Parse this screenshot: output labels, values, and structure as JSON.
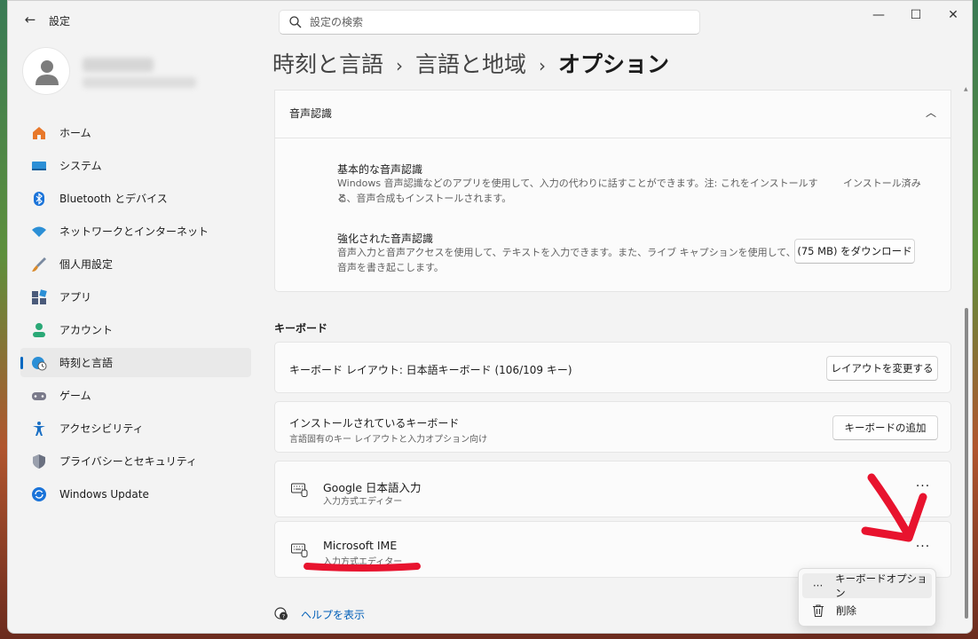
{
  "window": {
    "app_title": "設定",
    "back_icon": "back-arrow-icon",
    "controls": {
      "minimize": "—",
      "maximize": "☐",
      "close": "✕"
    }
  },
  "search": {
    "placeholder": "設定の検索"
  },
  "sidebar": {
    "items": [
      {
        "label": "ホーム",
        "icon": "home-icon",
        "color": "#e8782a"
      },
      {
        "label": "システム",
        "icon": "system-icon",
        "color": "#2b8fd6"
      },
      {
        "label": "Bluetooth とデバイス",
        "icon": "bluetooth-icon",
        "color": "#1a73d9"
      },
      {
        "label": "ネットワークとインターネット",
        "icon": "wifi-icon",
        "color": "#2b8fd6"
      },
      {
        "label": "個人用設定",
        "icon": "brush-icon",
        "color": "#d98a2b"
      },
      {
        "label": "アプリ",
        "icon": "apps-icon",
        "color": "#4a5a7a"
      },
      {
        "label": "アカウント",
        "icon": "account-icon",
        "color": "#2aa876"
      },
      {
        "label": "時刻と言語",
        "icon": "globe-clock-icon",
        "color": "#2b8fd6",
        "active": true
      },
      {
        "label": "ゲーム",
        "icon": "gamepad-icon",
        "color": "#7a7a8a"
      },
      {
        "label": "アクセシビリティ",
        "icon": "accessibility-icon",
        "color": "#1a6fc4"
      },
      {
        "label": "プライバシーとセキュリティ",
        "icon": "shield-icon",
        "color": "#6a7080"
      },
      {
        "label": "Windows Update",
        "icon": "update-icon",
        "color": "#1a73d9"
      }
    ]
  },
  "breadcrumb": {
    "level1": "時刻と言語",
    "level2": "言語と地域",
    "current": "オプション",
    "separator": "›"
  },
  "speech": {
    "title": "音声認識",
    "basic": {
      "title": "基本的な音声認識",
      "desc_line1": "Windows 音声認識などのアプリを使用して、入力の代わりに話すことができます。注: これをインストールする",
      "desc_line2": "と、音声合成もインストールされます。",
      "status": "インストール済み"
    },
    "enhanced": {
      "title": "強化された音声認識",
      "desc_line1": "音声入力と音声アクセスを使用して、テキストを入力できます。また、ライブ キャプションを使用して、",
      "desc_line2": "音声を書き起こします。",
      "button": "(75 MB) をダウンロード"
    }
  },
  "keyboard": {
    "section": "キーボード",
    "layout": {
      "label": "キーボード レイアウト: 日本語キーボード (106/109 キー)",
      "button": "レイアウトを変更する"
    },
    "installed": {
      "title": "インストールされているキーボード",
      "subtitle": "言語固有のキー レイアウトと入力オプション向け",
      "button": "キーボードの追加"
    },
    "imes": [
      {
        "name": "Google 日本語入力",
        "type": "入力方式エディター"
      },
      {
        "name": "Microsoft IME",
        "type": "入力方式エディター"
      }
    ],
    "more_label": "···"
  },
  "help": {
    "label": "ヘルプを表示"
  },
  "context_menu": {
    "items": [
      {
        "label": "キーボードオプション",
        "icon": "more-dots-icon"
      },
      {
        "label": "削除",
        "icon": "trash-icon"
      }
    ]
  },
  "colors": {
    "accent": "#0067c0",
    "annotation_red": "#e8132e",
    "link": "#005fb8"
  }
}
